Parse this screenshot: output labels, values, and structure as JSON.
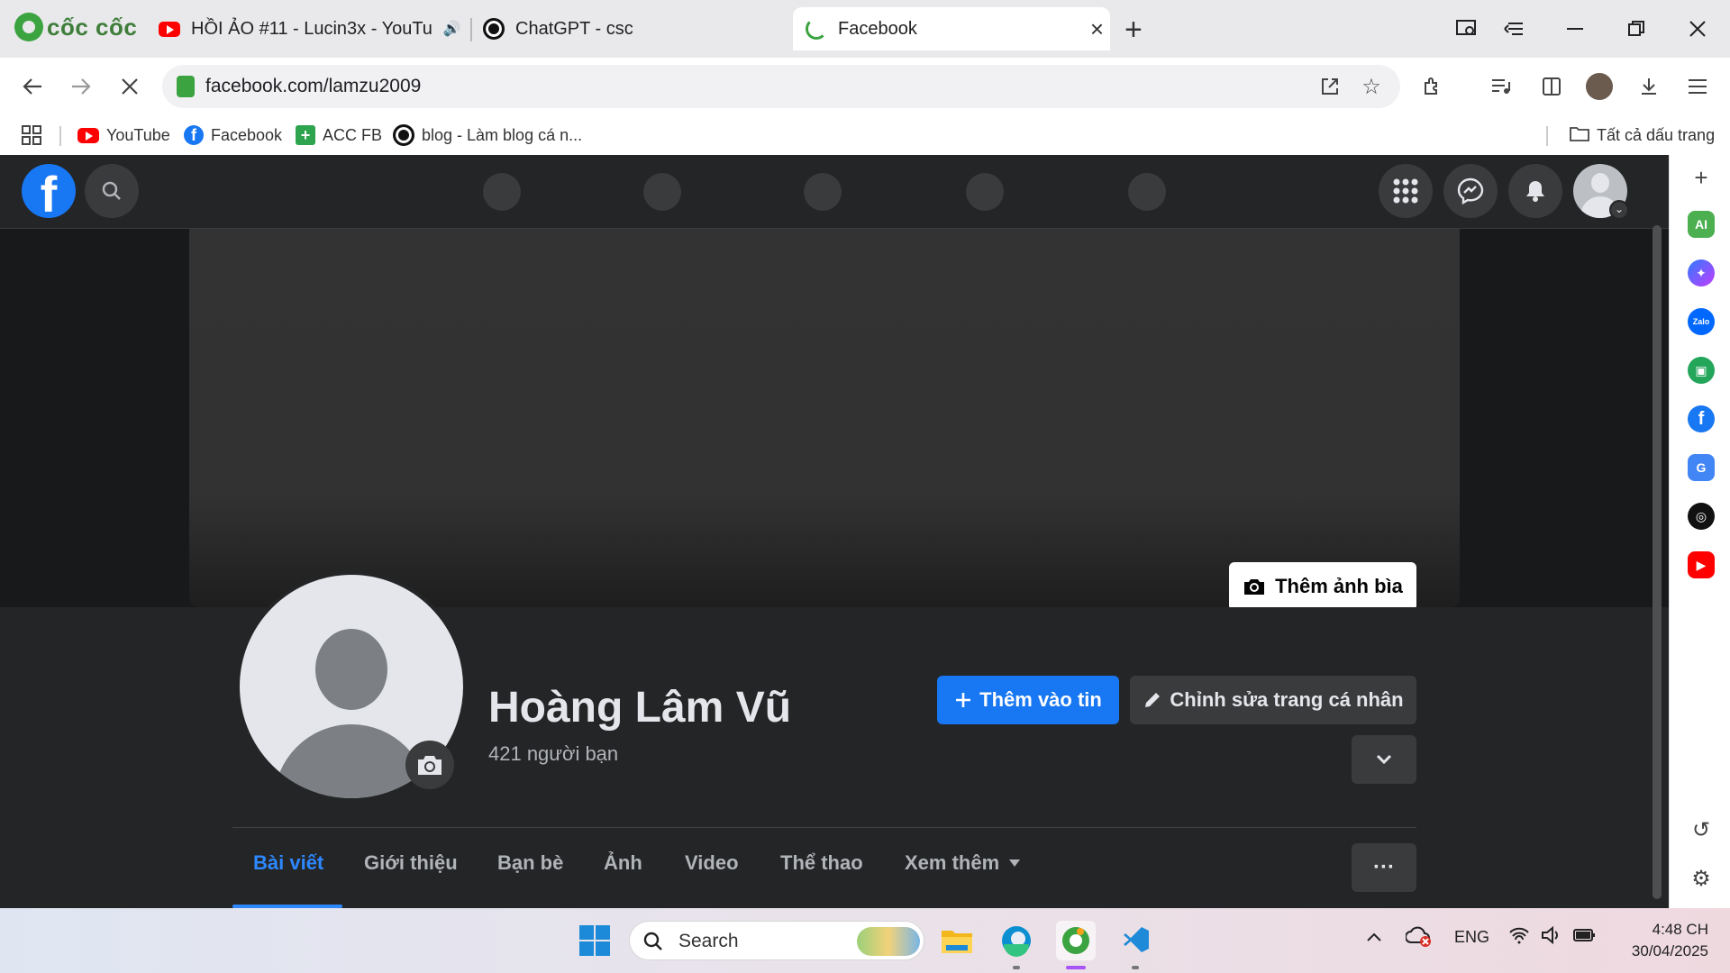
{
  "browser": {
    "brand": "cốc cốc",
    "tabs": [
      {
        "title": "HỒI ẢO #11 - Lucin3x - YouTu",
        "icon": "youtube-icon"
      },
      {
        "title": "ChatGPT - csc",
        "icon": "chatgpt-icon"
      },
      {
        "title": "Facebook",
        "icon": "loading-spinner-icon",
        "active": true
      }
    ],
    "url": "facebook.com/lamzu2009",
    "bookmarks": [
      {
        "label": "YouTube",
        "icon": "youtube-icon"
      },
      {
        "label": "Facebook",
        "icon": "facebook-icon"
      },
      {
        "label": "ACC FB",
        "icon": "plus-square-icon"
      },
      {
        "label": "blog - Làm blog cá n...",
        "icon": "chatgpt-icon"
      }
    ],
    "all_bookmarks": "Tất cả dấu trang"
  },
  "facebook": {
    "cover_button": "Thêm ảnh bìa",
    "profile_name": "Hoàng Lâm Vũ",
    "friends_count": "421 người bạn",
    "add_story_button": "Thêm vào tin",
    "edit_profile_button": "Chỉnh sửa trang cá nhân",
    "tabs": [
      "Bài viết",
      "Giới thiệu",
      "Bạn bè",
      "Ảnh",
      "Video",
      "Thể thao",
      "Xem thêm"
    ],
    "more_button": "···",
    "colors": {
      "accent": "#1877f2",
      "background": "#18191a",
      "surface": "#242526"
    }
  },
  "taskbar": {
    "search_placeholder": "Search",
    "language": "ENG",
    "time": "4:48 CH",
    "date": "30/04/2025"
  }
}
